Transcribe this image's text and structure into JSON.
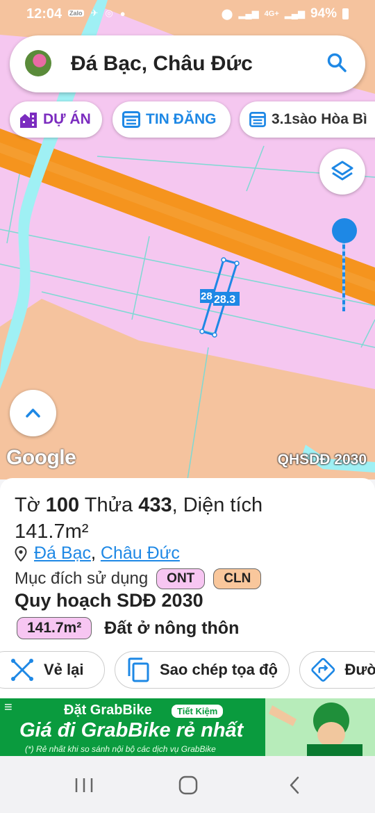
{
  "status_bar": {
    "time": "12:04",
    "app_icons": [
      "zalo-icon",
      "send-icon",
      "chrome-icon",
      "dot-icon"
    ],
    "network": "4G+",
    "battery": "94%"
  },
  "search": {
    "title": "Đá Bạc, Châu Đức"
  },
  "chips": [
    {
      "label": "DỰ ÁN",
      "icon": "building-icon"
    },
    {
      "label": "TIN ĐĂNG",
      "icon": "listing-icon"
    },
    {
      "label": "3.1sào Hòa Bì",
      "icon": "listing-icon"
    }
  ],
  "map": {
    "plot_label_1": "28",
    "plot_label_2": "28.3",
    "google_logo": "Google",
    "caption": "QHSDĐ 2030",
    "colors": {
      "residential": "#f5c7f0",
      "farmland": "#f5c39e",
      "road": "#f5941e",
      "water": "#9ff0f4",
      "accent": "#1e88e5"
    }
  },
  "panel": {
    "sheet_prefix": "Tờ",
    "sheet_no": "100",
    "plot_prefix": "Thửa",
    "plot_no": "433",
    "area_prefix": ", Diện tích",
    "area": "141.7m²",
    "commune": "Đá Bạc",
    "district": "Châu Đức",
    "purpose_label": "Mục đích sử dụng",
    "purpose_codes": [
      "ONT",
      "CLN"
    ],
    "plan_title": "Quy hoạch SDĐ 2030",
    "plan_area": "141.7m²",
    "plan_label": "Đất ở nông thôn"
  },
  "actions": {
    "redraw": "Vẻ lại",
    "copy": "Sao chép tọa độ",
    "route": "Đườ"
  },
  "ad": {
    "line1": "Đặt GrabBike",
    "tag": "Tiết Kiệm",
    "line2": "Giá đi GrabBike rẻ nhất",
    "line3": "(*) Rẻ nhất khi so sánh nội bộ các dịch vụ GrabBike"
  }
}
